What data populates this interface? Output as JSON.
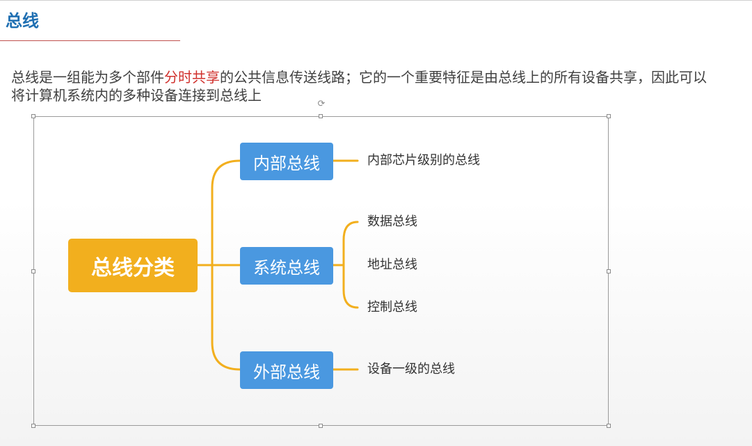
{
  "slide": {
    "title": "总线",
    "body_part1": "总线是一组能为多个部件",
    "body_highlight": "分时共享",
    "body_part2": "的公共信息传送线路；它的一个重要特征是由总线上的所有设备共享，因此可以将计算机系统内的多种设备连接到总线上"
  },
  "mindmap": {
    "root": "总线分类",
    "categories": [
      {
        "label": "内部总线",
        "children": [
          "内部芯片级别的总线"
        ]
      },
      {
        "label": "系统总线",
        "children": [
          "数据总线",
          "地址总线",
          "控制总线"
        ]
      },
      {
        "label": "外部总线",
        "children": [
          "设备一级的总线"
        ]
      }
    ]
  },
  "colors": {
    "title": "#1f6fb2",
    "highlight": "#d0312d",
    "root_node": "#f2af1e",
    "category_node": "#4a98e0",
    "connector": "#f2af1e"
  },
  "icons": {
    "rotate_handle": "rotate-handle-icon"
  }
}
